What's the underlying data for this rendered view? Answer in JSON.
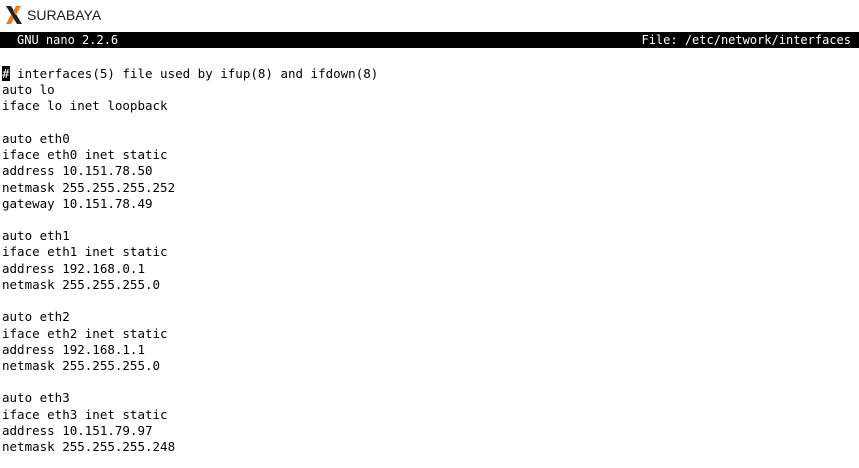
{
  "window": {
    "title": "SURABAYA",
    "icon": "xming-x-icon"
  },
  "nano": {
    "version": "GNU nano 2.2.6",
    "file_label": "File: /etc/network/interfaces"
  },
  "editor": {
    "cursor_char": "#",
    "lines": [
      " interfaces(5) file used by ifup(8) and ifdown(8)",
      "auto lo",
      "iface lo inet loopback",
      "",
      "auto eth0",
      "iface eth0 inet static",
      "address 10.151.78.50",
      "netmask 255.255.255.252",
      "gateway 10.151.78.49",
      "",
      "auto eth1",
      "iface eth1 inet static",
      "address 192.168.0.1",
      "netmask 255.255.255.0",
      "",
      "auto eth2",
      "iface eth2 inet static",
      "address 192.168.1.1",
      "netmask 255.255.255.0",
      "",
      "auto eth3",
      "iface eth3 inet static",
      "address 10.151.79.97",
      "netmask 255.255.255.248"
    ]
  }
}
